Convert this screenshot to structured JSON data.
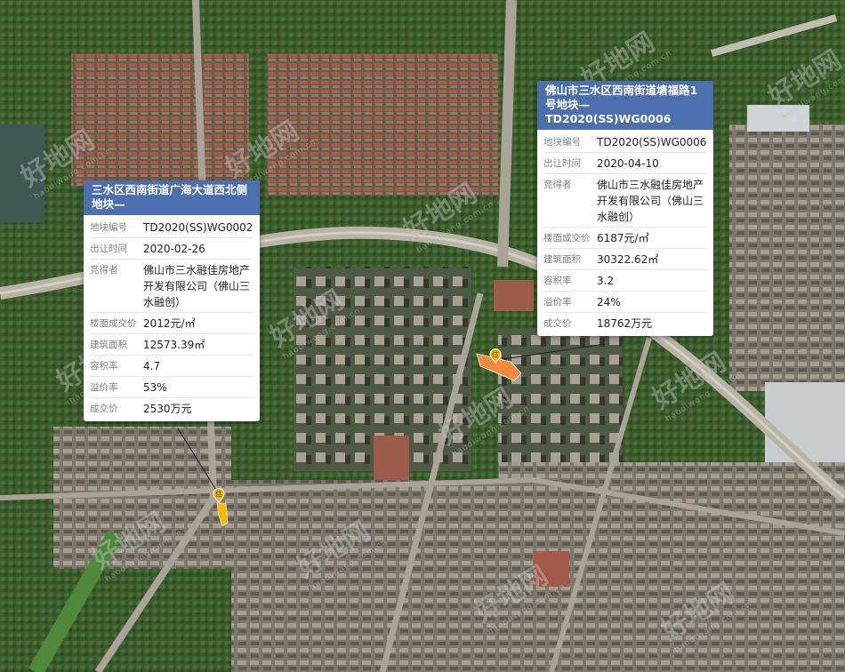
{
  "map": {
    "colors": {
      "vegetation": "#3d5a2e",
      "urban": "#8a8378",
      "roofs_red": "#9a5a48",
      "road": "#b9b3a6",
      "water": "#3f5a55",
      "card_header": "#4e6fae",
      "plot_orange": "#f08a3c",
      "plot_yellow": "#f5b800"
    },
    "watermark": {
      "text": "好地网",
      "sub": "haodiwang.com.cn",
      "icon": "logo-icon"
    }
  },
  "parcels": [
    {
      "title": "三水区西南街道广海大道西北侧地块—",
      "icon": "residential-pin-icon",
      "pin_label": "住",
      "rows": [
        {
          "key": "地块编号",
          "value": "TD2020(SS)WG0002"
        },
        {
          "key": "出让时间",
          "value": "2020-02-26"
        },
        {
          "key": "竞得者",
          "value": "佛山市三水融佳房地产开发有限公司（佛山三水融创）"
        },
        {
          "key": "楼面成交价",
          "value": "2012元/㎡"
        },
        {
          "key": "建筑面积",
          "value": "12573.39㎡"
        },
        {
          "key": "容积率",
          "value": "4.7"
        },
        {
          "key": "溢价率",
          "value": "53%"
        },
        {
          "key": "成交价",
          "value": "2530万元"
        }
      ]
    },
    {
      "title": "佛山市三水区西南街道塘福路1号地块—TD2020(SS)WG0006",
      "icon": "residential-pin-icon",
      "pin_label": "住",
      "rows": [
        {
          "key": "地块编号",
          "value": "TD2020(SS)WG0006"
        },
        {
          "key": "出让时间",
          "value": "2020-04-10"
        },
        {
          "key": "竞得者",
          "value": "佛山市三水融佳房地产开发有限公司（佛山三水融创）"
        },
        {
          "key": "楼面成交价",
          "value": "6187元/㎡"
        },
        {
          "key": "建筑面积",
          "value": "30322.62㎡"
        },
        {
          "key": "容积率",
          "value": "3.2"
        },
        {
          "key": "溢价率",
          "value": "24%"
        },
        {
          "key": "成交价",
          "value": "18762万元"
        }
      ]
    }
  ]
}
